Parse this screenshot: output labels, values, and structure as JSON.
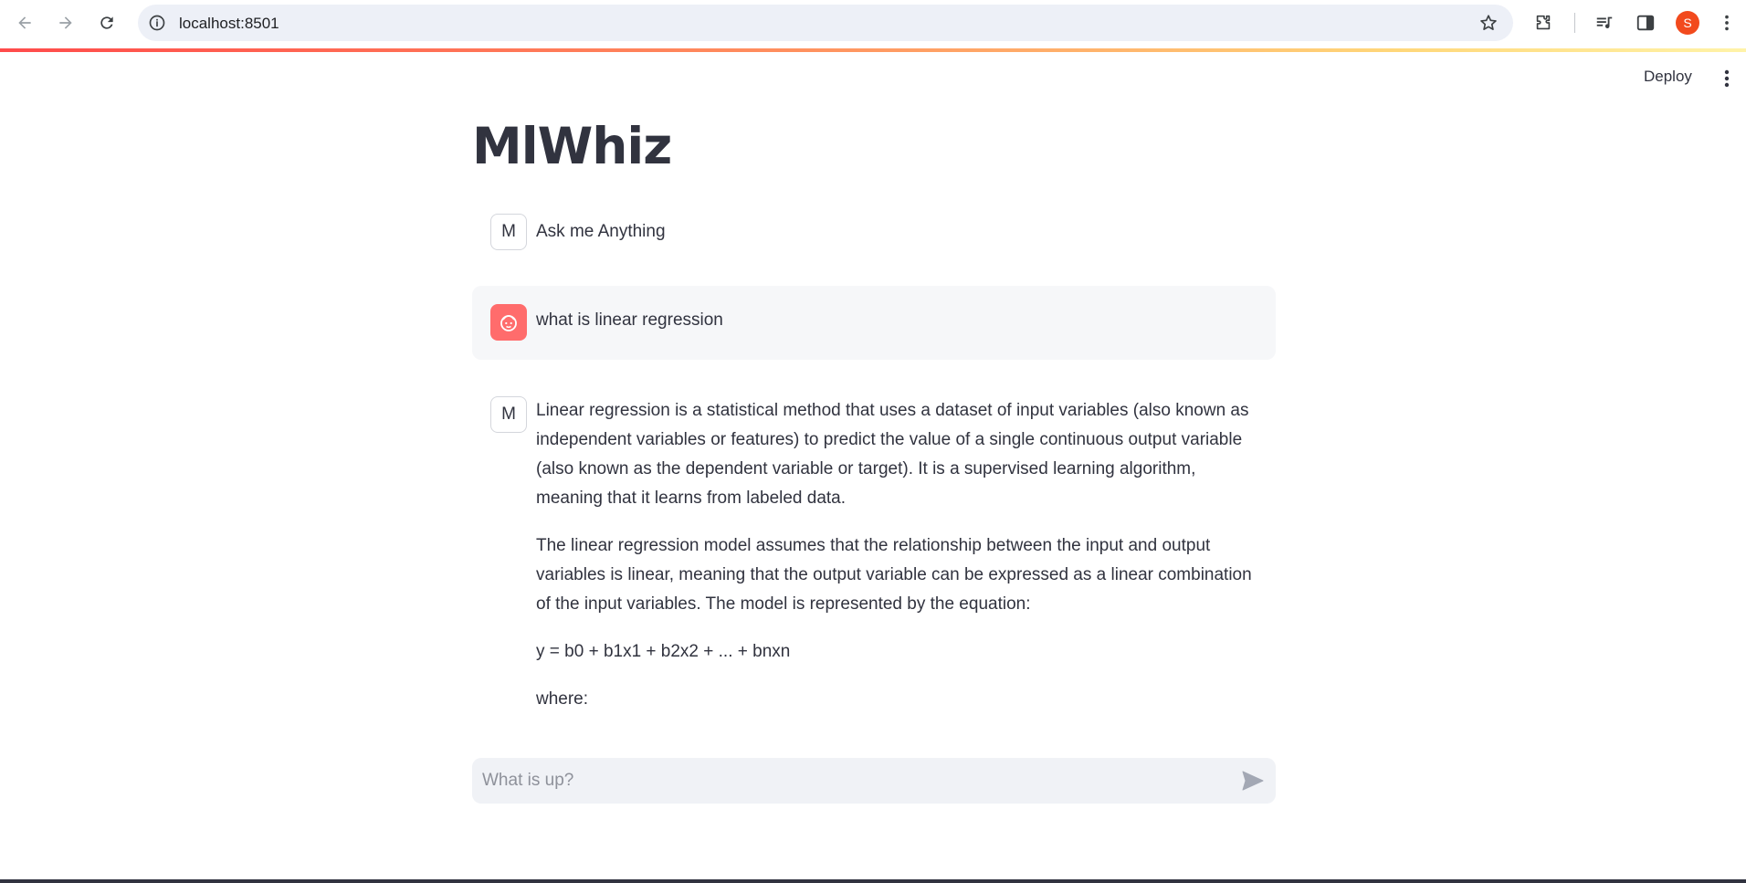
{
  "browser": {
    "url": "localhost:8501",
    "profile_initial": "S",
    "back_icon": "back-arrow-icon",
    "forward_icon": "forward-arrow-icon",
    "reload_icon": "reload-icon"
  },
  "app": {
    "deploy_label": "Deploy",
    "title": "MlWhiz",
    "accent_color": "#ff4b4b"
  },
  "messages": [
    {
      "role": "assistant",
      "avatar": "M",
      "paragraphs": [
        "Ask me Anything"
      ]
    },
    {
      "role": "user",
      "avatar_icon": "user-face-icon",
      "paragraphs": [
        "what is linear regression"
      ]
    },
    {
      "role": "assistant",
      "avatar": "M",
      "paragraphs": [
        "Linear regression is a statistical method that uses a dataset of input variables (also known as independent variables or features) to predict the value of a single continuous output variable (also known as the dependent variable or target). It is a supervised learning algorithm, meaning that it learns from labeled data.",
        "The linear regression model assumes that the relationship between the input and output variables is linear, meaning that the output variable can be expressed as a linear combination of the input variables. The model is represented by the equation:",
        "y = b0 + b1x1 + b2x2 + ... + bnxn",
        "where:"
      ]
    }
  ],
  "chat_input": {
    "placeholder": "What is up?",
    "value": ""
  }
}
